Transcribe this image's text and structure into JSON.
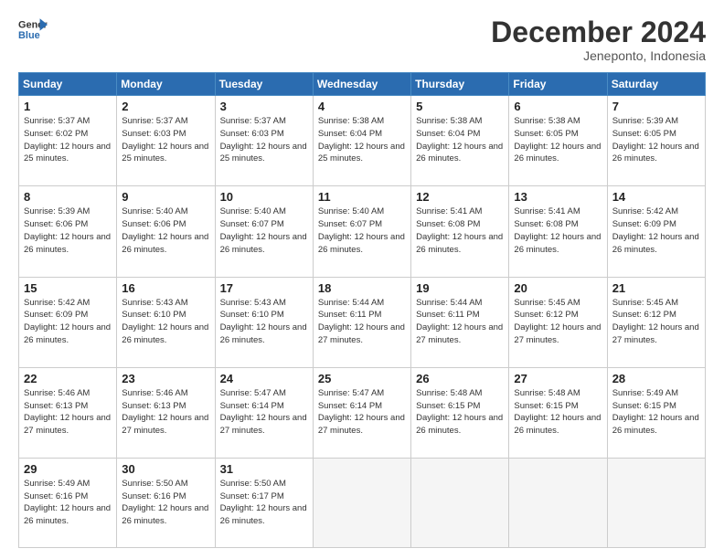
{
  "header": {
    "logo_line1": "General",
    "logo_line2": "Blue",
    "month": "December 2024",
    "location": "Jeneponto, Indonesia"
  },
  "weekdays": [
    "Sunday",
    "Monday",
    "Tuesday",
    "Wednesday",
    "Thursday",
    "Friday",
    "Saturday"
  ],
  "weeks": [
    [
      {
        "day": "1",
        "rise": "5:37 AM",
        "set": "6:02 PM",
        "daylight": "12 hours and 25 minutes."
      },
      {
        "day": "2",
        "rise": "5:37 AM",
        "set": "6:03 PM",
        "daylight": "12 hours and 25 minutes."
      },
      {
        "day": "3",
        "rise": "5:37 AM",
        "set": "6:03 PM",
        "daylight": "12 hours and 25 minutes."
      },
      {
        "day": "4",
        "rise": "5:38 AM",
        "set": "6:04 PM",
        "daylight": "12 hours and 25 minutes."
      },
      {
        "day": "5",
        "rise": "5:38 AM",
        "set": "6:04 PM",
        "daylight": "12 hours and 26 minutes."
      },
      {
        "day": "6",
        "rise": "5:38 AM",
        "set": "6:05 PM",
        "daylight": "12 hours and 26 minutes."
      },
      {
        "day": "7",
        "rise": "5:39 AM",
        "set": "6:05 PM",
        "daylight": "12 hours and 26 minutes."
      }
    ],
    [
      {
        "day": "8",
        "rise": "5:39 AM",
        "set": "6:06 PM",
        "daylight": "12 hours and 26 minutes."
      },
      {
        "day": "9",
        "rise": "5:40 AM",
        "set": "6:06 PM",
        "daylight": "12 hours and 26 minutes."
      },
      {
        "day": "10",
        "rise": "5:40 AM",
        "set": "6:07 PM",
        "daylight": "12 hours and 26 minutes."
      },
      {
        "day": "11",
        "rise": "5:40 AM",
        "set": "6:07 PM",
        "daylight": "12 hours and 26 minutes."
      },
      {
        "day": "12",
        "rise": "5:41 AM",
        "set": "6:08 PM",
        "daylight": "12 hours and 26 minutes."
      },
      {
        "day": "13",
        "rise": "5:41 AM",
        "set": "6:08 PM",
        "daylight": "12 hours and 26 minutes."
      },
      {
        "day": "14",
        "rise": "5:42 AM",
        "set": "6:09 PM",
        "daylight": "12 hours and 26 minutes."
      }
    ],
    [
      {
        "day": "15",
        "rise": "5:42 AM",
        "set": "6:09 PM",
        "daylight": "12 hours and 26 minutes."
      },
      {
        "day": "16",
        "rise": "5:43 AM",
        "set": "6:10 PM",
        "daylight": "12 hours and 26 minutes."
      },
      {
        "day": "17",
        "rise": "5:43 AM",
        "set": "6:10 PM",
        "daylight": "12 hours and 26 minutes."
      },
      {
        "day": "18",
        "rise": "5:44 AM",
        "set": "6:11 PM",
        "daylight": "12 hours and 27 minutes."
      },
      {
        "day": "19",
        "rise": "5:44 AM",
        "set": "6:11 PM",
        "daylight": "12 hours and 27 minutes."
      },
      {
        "day": "20",
        "rise": "5:45 AM",
        "set": "6:12 PM",
        "daylight": "12 hours and 27 minutes."
      },
      {
        "day": "21",
        "rise": "5:45 AM",
        "set": "6:12 PM",
        "daylight": "12 hours and 27 minutes."
      }
    ],
    [
      {
        "day": "22",
        "rise": "5:46 AM",
        "set": "6:13 PM",
        "daylight": "12 hours and 27 minutes."
      },
      {
        "day": "23",
        "rise": "5:46 AM",
        "set": "6:13 PM",
        "daylight": "12 hours and 27 minutes."
      },
      {
        "day": "24",
        "rise": "5:47 AM",
        "set": "6:14 PM",
        "daylight": "12 hours and 27 minutes."
      },
      {
        "day": "25",
        "rise": "5:47 AM",
        "set": "6:14 PM",
        "daylight": "12 hours and 27 minutes."
      },
      {
        "day": "26",
        "rise": "5:48 AM",
        "set": "6:15 PM",
        "daylight": "12 hours and 26 minutes."
      },
      {
        "day": "27",
        "rise": "5:48 AM",
        "set": "6:15 PM",
        "daylight": "12 hours and 26 minutes."
      },
      {
        "day": "28",
        "rise": "5:49 AM",
        "set": "6:15 PM",
        "daylight": "12 hours and 26 minutes."
      }
    ],
    [
      {
        "day": "29",
        "rise": "5:49 AM",
        "set": "6:16 PM",
        "daylight": "12 hours and 26 minutes."
      },
      {
        "day": "30",
        "rise": "5:50 AM",
        "set": "6:16 PM",
        "daylight": "12 hours and 26 minutes."
      },
      {
        "day": "31",
        "rise": "5:50 AM",
        "set": "6:17 PM",
        "daylight": "12 hours and 26 minutes."
      },
      null,
      null,
      null,
      null
    ]
  ]
}
